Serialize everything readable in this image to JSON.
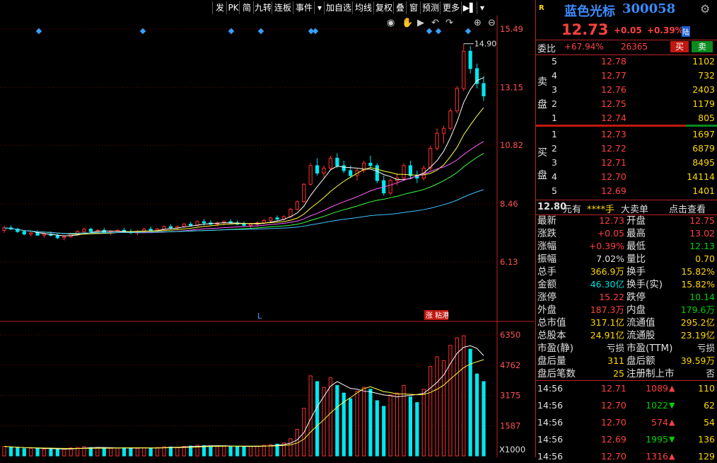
{
  "toolbar": {
    "items": [
      "发",
      "PK",
      "简",
      "九转",
      "连板",
      "事件",
      "▾",
      "加自选",
      "均线",
      "复权",
      "叠",
      "窗",
      "预测",
      "更多",
      "▶▌",
      "▾"
    ]
  },
  "chart": {
    "price_axis": [
      "15.49",
      "13.15",
      "10.82",
      "8.46",
      "6.13"
    ],
    "volume_axis": [
      "6350",
      "4762",
      "3175",
      "1587"
    ],
    "volume_unit": "X1000",
    "high_label": "14.90",
    "marker_l": "L",
    "tag": "涨 粘港",
    "icons": [
      "eye-icon",
      "hand-icon",
      "play-icon",
      "zoom-in-icon",
      "zoom-out-icon"
    ]
  },
  "chart_data": {
    "type": "candlestick",
    "candles": [
      [
        7.4,
        7.6,
        7.3,
        7.5
      ],
      [
        7.5,
        7.6,
        7.4,
        7.45
      ],
      [
        7.45,
        7.5,
        7.3,
        7.35
      ],
      [
        7.35,
        7.4,
        7.2,
        7.25
      ],
      [
        7.25,
        7.35,
        7.15,
        7.3
      ],
      [
        7.3,
        7.4,
        7.2,
        7.2
      ],
      [
        7.2,
        7.3,
        7.1,
        7.25
      ],
      [
        7.25,
        7.35,
        7.15,
        7.2
      ],
      [
        7.2,
        7.25,
        7.05,
        7.1
      ],
      [
        7.1,
        7.2,
        7.0,
        7.15
      ],
      [
        7.15,
        7.3,
        7.1,
        7.25
      ],
      [
        7.25,
        7.4,
        7.2,
        7.35
      ],
      [
        7.35,
        7.5,
        7.3,
        7.45
      ],
      [
        7.45,
        7.5,
        7.3,
        7.35
      ],
      [
        7.35,
        7.45,
        7.25,
        7.4
      ],
      [
        7.4,
        7.5,
        7.3,
        7.3
      ],
      [
        7.3,
        7.4,
        7.2,
        7.35
      ],
      [
        7.35,
        7.45,
        7.3,
        7.4
      ],
      [
        7.4,
        7.5,
        7.3,
        7.35
      ],
      [
        7.35,
        7.45,
        7.25,
        7.3
      ],
      [
        7.3,
        7.4,
        7.2,
        7.35
      ],
      [
        7.35,
        7.5,
        7.3,
        7.45
      ],
      [
        7.45,
        7.55,
        7.35,
        7.4
      ],
      [
        7.4,
        7.5,
        7.3,
        7.45
      ],
      [
        7.45,
        7.6,
        7.4,
        7.55
      ],
      [
        7.55,
        7.65,
        7.45,
        7.5
      ],
      [
        7.5,
        7.6,
        7.4,
        7.55
      ],
      [
        7.55,
        7.7,
        7.5,
        7.65
      ],
      [
        7.65,
        7.75,
        7.55,
        7.6
      ],
      [
        7.6,
        7.8,
        7.55,
        7.75
      ],
      [
        7.75,
        7.85,
        7.6,
        7.7
      ],
      [
        7.7,
        7.8,
        7.6,
        7.65
      ],
      [
        7.65,
        7.75,
        7.55,
        7.7
      ],
      [
        7.7,
        7.8,
        7.6,
        7.75
      ],
      [
        7.75,
        7.85,
        7.65,
        7.7
      ],
      [
        7.7,
        7.8,
        7.6,
        7.65
      ],
      [
        7.65,
        7.75,
        7.55,
        7.6
      ],
      [
        7.6,
        7.7,
        7.5,
        7.65
      ],
      [
        7.65,
        7.75,
        7.55,
        7.7
      ],
      [
        7.7,
        7.85,
        7.65,
        7.8
      ],
      [
        7.8,
        7.95,
        7.7,
        7.9
      ],
      [
        7.9,
        8.0,
        7.8,
        7.85
      ],
      [
        7.85,
        8.0,
        7.8,
        7.95
      ],
      [
        7.95,
        8.3,
        7.9,
        8.25
      ],
      [
        8.25,
        8.6,
        8.2,
        8.55
      ],
      [
        8.55,
        9.3,
        8.5,
        9.25
      ],
      [
        9.25,
        10.1,
        9.2,
        10.0
      ],
      [
        10.0,
        10.3,
        9.6,
        9.7
      ],
      [
        9.7,
        10.0,
        9.5,
        9.9
      ],
      [
        9.9,
        10.4,
        9.8,
        10.3
      ],
      [
        10.3,
        10.5,
        9.9,
        10.0
      ],
      [
        10.0,
        10.2,
        9.7,
        9.8
      ],
      [
        9.8,
        10.0,
        9.5,
        9.6
      ],
      [
        9.6,
        9.9,
        9.4,
        9.8
      ],
      [
        9.8,
        10.2,
        9.7,
        10.1
      ],
      [
        10.1,
        10.4,
        9.9,
        10.0
      ],
      [
        10.0,
        10.1,
        9.3,
        9.4
      ],
      [
        9.4,
        9.6,
        8.8,
        8.9
      ],
      [
        8.9,
        9.5,
        8.8,
        9.4
      ],
      [
        9.4,
        9.7,
        9.2,
        9.5
      ],
      [
        9.5,
        10.1,
        9.4,
        10.0
      ],
      [
        10.0,
        10.2,
        9.5,
        9.6
      ],
      [
        9.6,
        9.8,
        9.3,
        9.5
      ],
      [
        9.5,
        10.0,
        9.4,
        9.9
      ],
      [
        9.9,
        10.8,
        9.8,
        10.7
      ],
      [
        10.7,
        11.5,
        10.6,
        11.3
      ],
      [
        11.3,
        11.6,
        10.9,
        11.5
      ],
      [
        11.5,
        12.3,
        11.4,
        12.2
      ],
      [
        12.2,
        13.2,
        12.1,
        13.1
      ],
      [
        13.1,
        14.9,
        13.0,
        14.6
      ],
      [
        14.6,
        14.8,
        13.7,
        13.9
      ],
      [
        13.9,
        14.1,
        13.1,
        13.3
      ],
      [
        13.3,
        13.6,
        12.6,
        12.8
      ]
    ],
    "volumes": [
      500,
      450,
      420,
      380,
      400,
      390,
      360,
      370,
      340,
      350,
      420,
      450,
      480,
      440,
      430,
      410,
      400,
      420,
      430,
      410,
      400,
      430,
      420,
      440,
      480,
      470,
      460,
      500,
      520,
      560,
      540,
      530,
      510,
      520,
      500,
      490,
      480,
      500,
      520,
      560,
      600,
      620,
      680,
      900,
      1400,
      2500,
      4200,
      3900,
      3600,
      4100,
      3700,
      3300,
      3000,
      3400,
      3600,
      3500,
      2900,
      2600,
      3200,
      3300,
      3700,
      3100,
      2800,
      3500,
      4700,
      5200,
      5000,
      5800,
      6200,
      6300,
      5600,
      4300,
      3900
    ],
    "price_ticks": [
      15.49,
      13.15,
      10.82,
      8.46,
      6.13
    ],
    "volume_ticks": [
      6350,
      4762,
      3175,
      1587
    ]
  },
  "quote": {
    "code_tag": "R",
    "name": "蓝色光标",
    "code": "300058",
    "price": "12.73",
    "change": "+0.05",
    "pct": "+0.39%",
    "lu": "陆",
    "weibi_label": "委比",
    "weibi_pct": "+67.94%",
    "weibi_diff": "26365",
    "buy_btn": "买",
    "sell_btn": "卖",
    "sell_label": "卖盘",
    "buy_label": "买盘",
    "asks": [
      {
        "level": "5",
        "price": "12.78",
        "vol": "1102"
      },
      {
        "level": "4",
        "price": "12.77",
        "vol": "732"
      },
      {
        "level": "3",
        "price": "12.76",
        "vol": "2403"
      },
      {
        "level": "2",
        "price": "12.75",
        "vol": "1179"
      },
      {
        "level": "1",
        "price": "12.74",
        "vol": "805"
      }
    ],
    "bids": [
      {
        "level": "1",
        "price": "12.73",
        "vol": "1697"
      },
      {
        "level": "2",
        "price": "12.72",
        "vol": "6879"
      },
      {
        "level": "3",
        "price": "12.71",
        "vol": "8495"
      },
      {
        "level": "4",
        "price": "12.70",
        "vol": "14114"
      },
      {
        "level": "5",
        "price": "12.69",
        "vol": "1401"
      }
    ],
    "bigorder": {
      "price": "12.80",
      "unit": "元有",
      "stars": "****手",
      "label": "大卖单",
      "link": "点击查看"
    },
    "stats": [
      {
        "l1": "最新",
        "v1": "12.73",
        "c1": "r",
        "l2": "开盘",
        "v2": "12.75",
        "c2": "r"
      },
      {
        "l1": "涨跌",
        "v1": "+0.05",
        "c1": "r",
        "l2": "最高",
        "v2": "13.02",
        "c2": "r"
      },
      {
        "l1": "涨幅",
        "v1": "+0.39%",
        "c1": "r",
        "l2": "最低",
        "v2": "12.13",
        "c2": "g"
      },
      {
        "l1": "振幅",
        "v1": "7.02%",
        "c1": "w",
        "l2": "量比",
        "v2": "0.70",
        "c2": "y"
      },
      {
        "l1": "总手",
        "v1": "366.9万",
        "c1": "y",
        "l2": "换手",
        "v2": "15.82%",
        "c2": "y"
      },
      {
        "l1": "金额",
        "v1": "46.30亿",
        "c1": "c",
        "l2": "换手(实)",
        "v2": "15.82%",
        "c2": "y"
      },
      {
        "l1": "涨停",
        "v1": "15.22",
        "c1": "r",
        "l2": "跌停",
        "v2": "10.14",
        "c2": "g"
      },
      {
        "l1": "外盘",
        "v1": "187.3万",
        "c1": "r",
        "l2": "内盘",
        "v2": "179.6万",
        "c2": "g"
      },
      {
        "l1": "总市值",
        "v1": "317.1亿",
        "c1": "y",
        "l2": "流通值",
        "v2": "295.2亿",
        "c2": "y"
      },
      {
        "l1": "总股本",
        "v1": "24.91亿",
        "c1": "y",
        "l2": "流通股",
        "v2": "23.19亿",
        "c2": "y"
      },
      {
        "l1": "市盈(静)",
        "v1": "亏损",
        "c1": "w",
        "l2": "市盈(TTM)",
        "v2": "亏损",
        "c2": "w"
      },
      {
        "l1": "盘后量",
        "v1": "311",
        "c1": "y",
        "l2": "盘后额",
        "v2": "39.59万",
        "c2": "y"
      },
      {
        "l1": "盘后笔数",
        "v1": "25",
        "c1": "y",
        "l2": "注册制上市",
        "v2": "否",
        "c2": "w"
      }
    ],
    "ticks": [
      {
        "time": "14:56",
        "price": "12.71",
        "vol": "1089",
        "dir": "up",
        "n": "110"
      },
      {
        "time": "14:56",
        "price": "12.70",
        "vol": "1022",
        "dir": "down",
        "n": "62"
      },
      {
        "time": "14:56",
        "price": "12.70",
        "vol": "574",
        "dir": "up",
        "n": "54"
      },
      {
        "time": "14:56",
        "price": "12.69",
        "vol": "1995",
        "dir": "down",
        "n": "136"
      },
      {
        "time": "14:56",
        "price": "12.70",
        "vol": "1316",
        "dir": "up",
        "n": "129"
      }
    ]
  }
}
